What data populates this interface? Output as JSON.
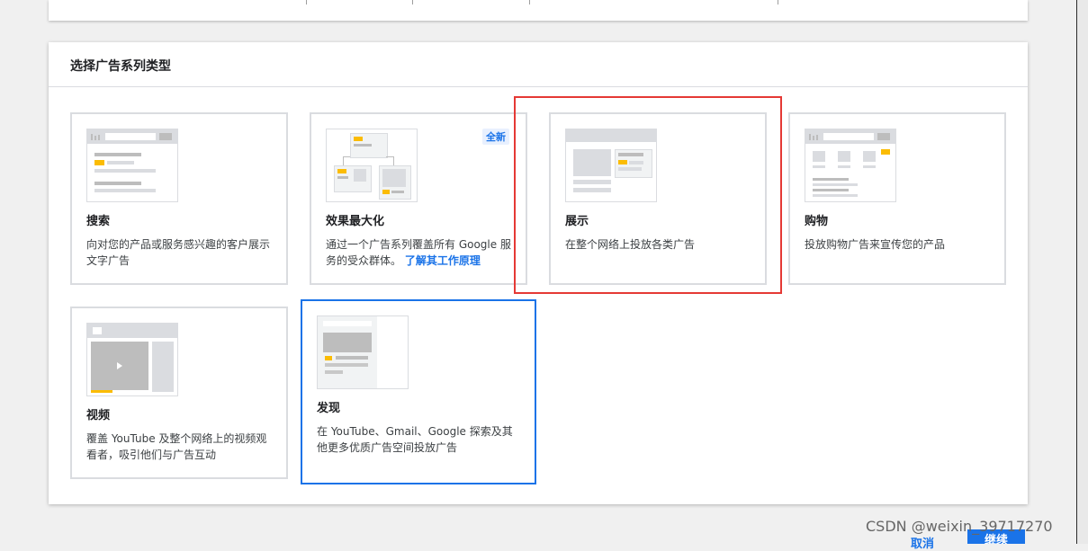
{
  "section": {
    "title": "选择广告系列类型"
  },
  "tiles": [
    {
      "name": "搜索",
      "description": "向对您的产品或服务感兴趣的客户展示文字广告"
    },
    {
      "name": "效果最大化",
      "badge": "全新",
      "description": "通过一个广告系列覆盖所有 Google 服务的受众群体。",
      "link": "了解其工作原理"
    },
    {
      "name": "展示",
      "description": "在整个网络上投放各类广告"
    },
    {
      "name": "购物",
      "description": "投放购物广告来宣传您的产品"
    },
    {
      "name": "视频",
      "description": "覆盖 YouTube 及整个网络上的视频观看者，吸引他们与广告互动"
    },
    {
      "name": "发现",
      "description": "在 YouTube、Gmail、Google 探索及其他更多优质广告空间投放广告"
    }
  ],
  "footer": {
    "cancel_label": "取消",
    "continue_label": "继续"
  },
  "watermark": "CSDN @weixin_39717270",
  "colors": {
    "accent": "#1a73e8",
    "highlight": "#e53935",
    "thumbnail_accent": "#fbbc04"
  },
  "icons": [
    "search-thumbnail",
    "performance-max-thumbnail",
    "display-thumbnail",
    "shopping-thumbnail",
    "video-thumbnail",
    "discovery-thumbnail"
  ]
}
